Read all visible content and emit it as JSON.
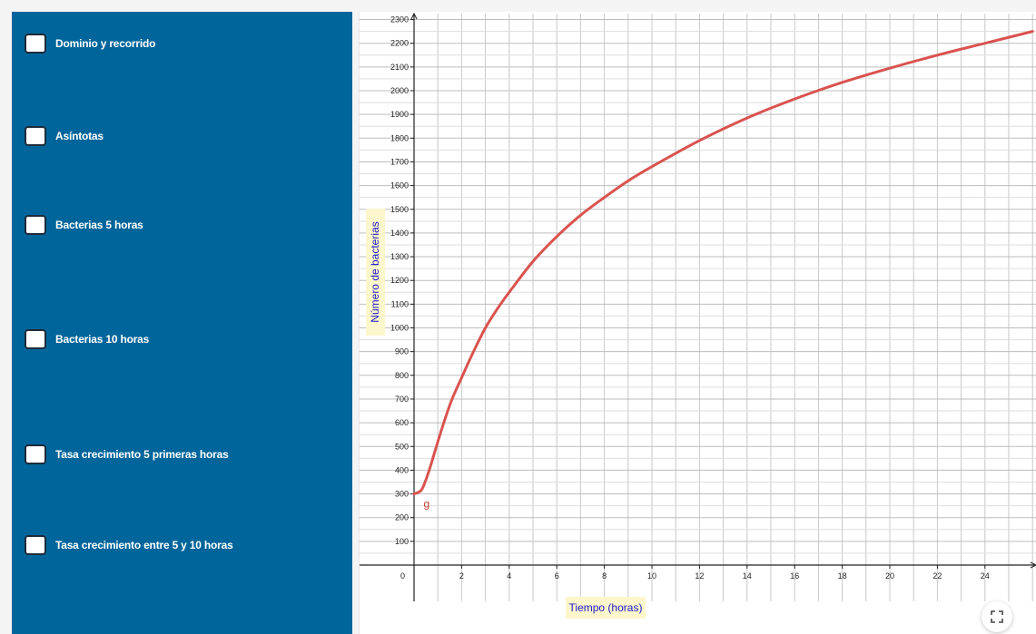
{
  "sidebar": {
    "items": [
      {
        "label": "Dominio y recorrido",
        "checked": false
      },
      {
        "label": "Asíntotas",
        "checked": false
      },
      {
        "label": "Bacterias 5 horas",
        "checked": false
      },
      {
        "label": "Bacterias 10 horas",
        "checked": false
      },
      {
        "label": "Tasa crecimiento 5 primeras horas",
        "checked": false
      },
      {
        "label": "Tasa crecimiento entre 5 y 10 horas",
        "checked": false
      }
    ]
  },
  "graph": {
    "function_label": "g",
    "fullscreen_icon": "fullscreen-icon"
  },
  "chart_data": {
    "type": "line",
    "xlabel": "Tiempo (horas)",
    "ylabel": "Número de bacterias",
    "xlim": [
      0,
      26
    ],
    "ylim": [
      0,
      2300
    ],
    "x_ticks": [
      2,
      4,
      6,
      8,
      10,
      12,
      14,
      16,
      18,
      20,
      22,
      24
    ],
    "y_ticks": [
      100,
      200,
      300,
      400,
      500,
      600,
      700,
      800,
      900,
      1000,
      1100,
      1200,
      1300,
      1400,
      1500,
      1600,
      1700,
      1800,
      1900,
      2000,
      2100,
      2200,
      2300
    ],
    "origin_label": "0",
    "grid": true,
    "series": [
      {
        "name": "g",
        "color": "#d9534f",
        "x": [
          0,
          0.3,
          0.5,
          0.7,
          1,
          1.3,
          1.6,
          2,
          2.5,
          3,
          3.5,
          4,
          5,
          6,
          7,
          8,
          9,
          10,
          12,
          14,
          16,
          18,
          20,
          22,
          24,
          26
        ],
        "y": [
          300,
          315,
          360,
          420,
          520,
          615,
          700,
          790,
          900,
          1000,
          1080,
          1150,
          1280,
          1385,
          1475,
          1550,
          1620,
          1680,
          1790,
          1885,
          1965,
          2035,
          2095,
          2150,
          2200,
          2250
        ]
      }
    ]
  }
}
